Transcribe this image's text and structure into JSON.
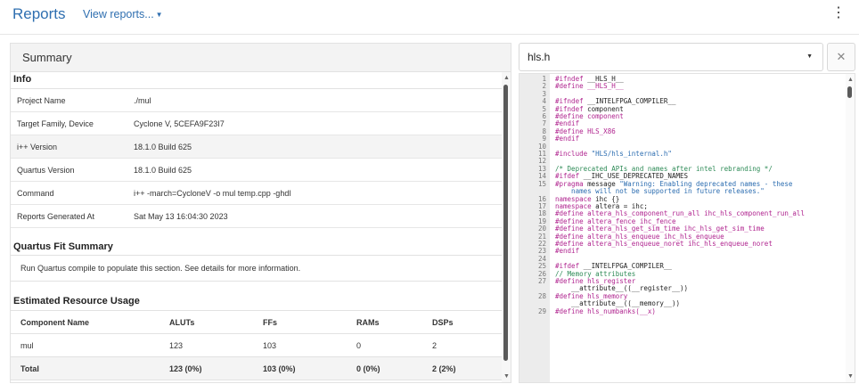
{
  "header": {
    "title": "Reports",
    "view_reports": "View reports...",
    "accent_color": "#2f6fb0"
  },
  "summary": {
    "heading": "Summary",
    "info": {
      "title": "Info",
      "rows": [
        {
          "key": "Project Name",
          "value": "./mul"
        },
        {
          "key": "Target Family, Device",
          "value": "Cyclone V, 5CEFA9F23I7"
        },
        {
          "key": "i++ Version",
          "value": "18.1.0 Build 625"
        },
        {
          "key": "Quartus Version",
          "value": "18.1.0 Build 625"
        },
        {
          "key": "Command",
          "value": "i++ -march=CycloneV -o mul temp.cpp -ghdl"
        },
        {
          "key": "Reports Generated At",
          "value": "Sat May 13 16:04:30 2023"
        }
      ]
    },
    "fit": {
      "title": "Quartus Fit Summary",
      "message": "Run Quartus compile to populate this section. See details for more information."
    },
    "resources": {
      "title": "Estimated Resource Usage",
      "columns": [
        "Component Name",
        "ALUTs",
        "FFs",
        "RAMs",
        "DSPs"
      ],
      "rows": [
        [
          "mul",
          "123",
          "103",
          "0",
          "2"
        ]
      ],
      "total": [
        "Total",
        "123 (0%)",
        "103 (0%)",
        "0 (0%)",
        "2 (2%)"
      ]
    }
  },
  "editor": {
    "file": "hls.h",
    "close_icon": "close-icon",
    "colors": {
      "directive": "#b0248f",
      "comment": "#2e8b57",
      "string": "#2b6cb0",
      "default": "#222222"
    },
    "lines": [
      {
        "n": "1",
        "segs": [
          {
            "t": "#ifndef",
            "c": "directive"
          },
          {
            "t": " __HLS_H__",
            "c": "default"
          }
        ]
      },
      {
        "n": "2",
        "segs": [
          {
            "t": "#define __HLS_H__",
            "c": "directive"
          }
        ]
      },
      {
        "n": "3",
        "segs": []
      },
      {
        "n": "4",
        "segs": [
          {
            "t": "#ifndef",
            "c": "directive"
          },
          {
            "t": " __INTELFPGA_COMPILER__",
            "c": "default"
          }
        ]
      },
      {
        "n": "5",
        "segs": [
          {
            "t": "#ifndef",
            "c": "directive"
          },
          {
            "t": " component",
            "c": "default"
          }
        ]
      },
      {
        "n": "6",
        "segs": [
          {
            "t": "#define component",
            "c": "directive"
          }
        ]
      },
      {
        "n": "7",
        "segs": [
          {
            "t": "#endif",
            "c": "directive"
          }
        ]
      },
      {
        "n": "8",
        "segs": [
          {
            "t": "#define HLS_X86",
            "c": "directive"
          }
        ]
      },
      {
        "n": "9",
        "segs": [
          {
            "t": "#endif",
            "c": "directive"
          }
        ]
      },
      {
        "n": "10",
        "segs": []
      },
      {
        "n": "11",
        "segs": [
          {
            "t": "#include",
            "c": "directive"
          },
          {
            "t": " \"HLS/hls_internal.h\"",
            "c": "string"
          }
        ]
      },
      {
        "n": "12",
        "segs": []
      },
      {
        "n": "13",
        "segs": [
          {
            "t": "/* Deprecated APIs and names after intel rebranding */",
            "c": "comment"
          }
        ]
      },
      {
        "n": "14",
        "segs": [
          {
            "t": "#ifdef",
            "c": "directive"
          },
          {
            "t": " __IHC_USE_DEPRECATED_NAMES",
            "c": "default"
          }
        ]
      },
      {
        "n": "15",
        "segs": [
          {
            "t": "#pragma",
            "c": "directive"
          },
          {
            "t": " message ",
            "c": "default"
          },
          {
            "t": "\"Warning: Enabling deprecated names - these",
            "c": "string"
          }
        ]
      },
      {
        "n": "",
        "segs": [
          {
            "t": "    names will not be supported in future releases.\"",
            "c": "string"
          }
        ]
      },
      {
        "n": "16",
        "segs": [
          {
            "t": "namespace",
            "c": "directive"
          },
          {
            "t": " ihc {}",
            "c": "default"
          }
        ]
      },
      {
        "n": "17",
        "segs": [
          {
            "t": "namespace",
            "c": "directive"
          },
          {
            "t": " altera = ihc;",
            "c": "default"
          }
        ]
      },
      {
        "n": "18",
        "segs": [
          {
            "t": "#define altera_hls_component_run_all ihc_hls_component_run_all",
            "c": "directive"
          }
        ]
      },
      {
        "n": "19",
        "segs": [
          {
            "t": "#define altera_fence ihc_fence",
            "c": "directive"
          }
        ]
      },
      {
        "n": "20",
        "segs": [
          {
            "t": "#define altera_hls_get_sim_time ihc_hls_get_sim_time",
            "c": "directive"
          }
        ]
      },
      {
        "n": "21",
        "segs": [
          {
            "t": "#define altera_hls_enqueue ihc_hls_enqueue",
            "c": "directive"
          }
        ]
      },
      {
        "n": "22",
        "segs": [
          {
            "t": "#define altera_hls_enqueue_noret ihc_hls_enqueue_noret",
            "c": "directive"
          }
        ]
      },
      {
        "n": "23",
        "segs": [
          {
            "t": "#endif",
            "c": "directive"
          }
        ]
      },
      {
        "n": "24",
        "segs": []
      },
      {
        "n": "25",
        "segs": [
          {
            "t": "#ifdef",
            "c": "directive"
          },
          {
            "t": " __INTELFPGA_COMPILER__",
            "c": "default"
          }
        ]
      },
      {
        "n": "26",
        "segs": [
          {
            "t": "// Memory attributes",
            "c": "comment"
          }
        ]
      },
      {
        "n": "27",
        "segs": [
          {
            "t": "#define hls_register",
            "c": "directive"
          }
        ]
      },
      {
        "n": "",
        "segs": [
          {
            "t": "    __attribute__((__register__))",
            "c": "default"
          }
        ]
      },
      {
        "n": "28",
        "segs": [
          {
            "t": "#define hls_memory",
            "c": "directive"
          }
        ]
      },
      {
        "n": "",
        "segs": [
          {
            "t": "    __attribute__((__memory__))",
            "c": "default"
          }
        ]
      },
      {
        "n": "29",
        "segs": [
          {
            "t": "#define hls_numbanks(__x)",
            "c": "directive"
          }
        ]
      }
    ]
  }
}
